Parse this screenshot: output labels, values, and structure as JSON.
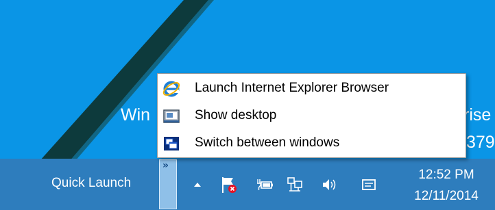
{
  "desktop": {
    "watermark_left": "Win",
    "watermark_right": "rise",
    "watermark_right2": "379"
  },
  "taskbar": {
    "quick_launch_label": "Quick Launch",
    "overflow_chevron": "»",
    "tray_icons": [
      "show-hidden-icons-arrow-icon",
      "action-center-flag-icon",
      "power-battery-icon",
      "network-icon",
      "volume-icon",
      "notifications-icon"
    ]
  },
  "clock": {
    "time": "12:52 PM",
    "date": "12/11/2014"
  },
  "quick_launch_menu": {
    "items": [
      {
        "label": "Launch Internet Explorer Browser",
        "icon": "internet-explorer-icon"
      },
      {
        "label": "Show desktop",
        "icon": "show-desktop-icon"
      },
      {
        "label": "Switch between windows",
        "icon": "switch-windows-icon"
      }
    ]
  },
  "colors": {
    "desktop_background": "#0a95e6",
    "taskbar": "#2e7dbd",
    "menu_background": "#ffffff",
    "overflow_button": "#8fc0e8"
  }
}
